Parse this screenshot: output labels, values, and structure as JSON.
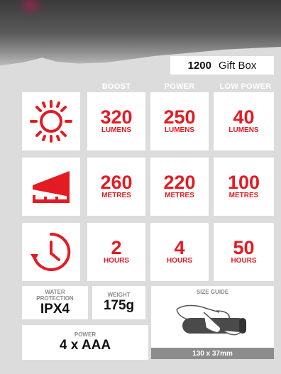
{
  "product": {
    "model": "1200",
    "variant": "Gift Box"
  },
  "columns": [
    "BOOST",
    "POWER",
    "LOW POWER"
  ],
  "rows": [
    {
      "icon": "sun-icon",
      "values": [
        "320",
        "250",
        "40"
      ],
      "unit": "LUMENS"
    },
    {
      "icon": "range-icon",
      "values": [
        "260",
        "220",
        "100"
      ],
      "unit": "METRES"
    },
    {
      "icon": "clock-icon",
      "values": [
        "2",
        "4",
        "50"
      ],
      "unit": "HOURS"
    }
  ],
  "specs": {
    "water_label": "WATER PROTECTION",
    "water_value": "IPX4",
    "weight_label": "WEIGHT",
    "weight_value": "175g",
    "power_label": "POWER",
    "power_value": "4 x AAA",
    "size_label": "SIZE GUIDE",
    "size_value": "130 x 37mm"
  },
  "colors": {
    "accent": "#e31b23",
    "background": "#dcdcdc",
    "panel": "#ffffff"
  }
}
